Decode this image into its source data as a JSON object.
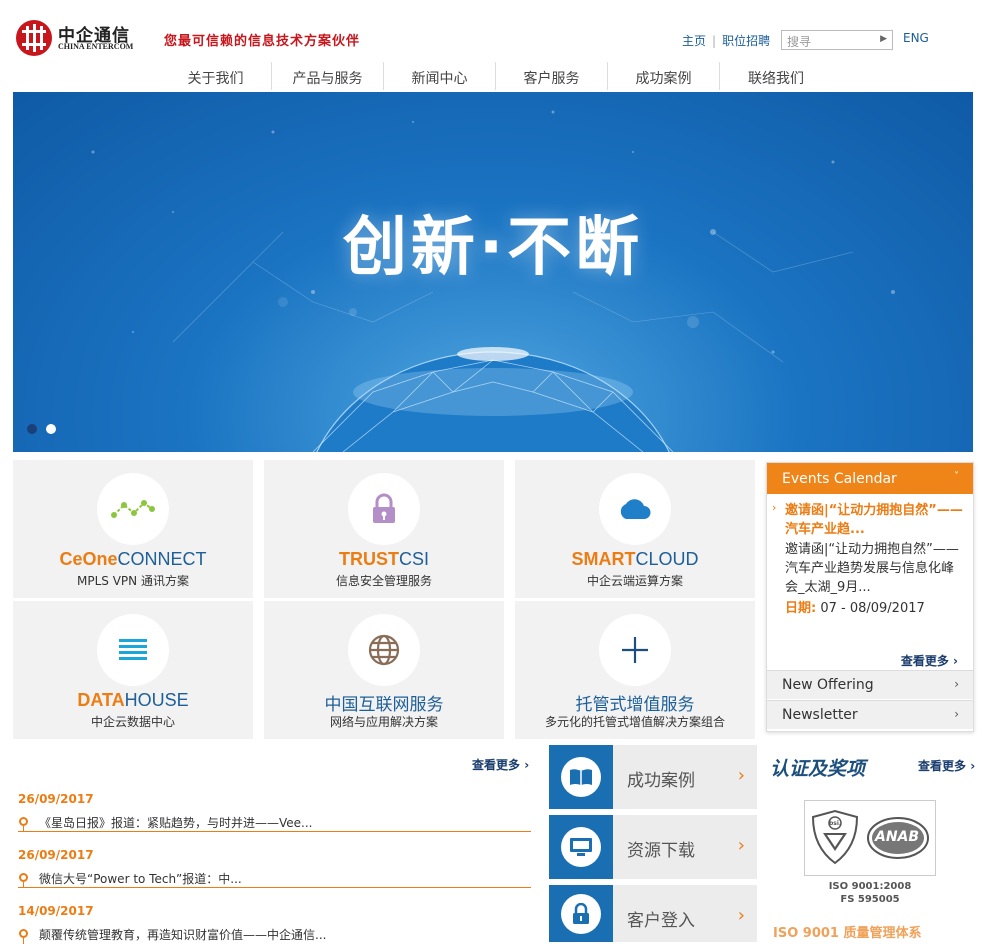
{
  "header": {
    "logo_cn": "中企通信",
    "logo_en": "CHINA ENTERCOM",
    "slogan": "您最可信赖的信息技术方案伙伴",
    "links": [
      "主页",
      "职位招聘"
    ],
    "search_placeholder": "搜寻",
    "lang": "ENG"
  },
  "nav": [
    "关于我们",
    "产品与服务",
    "新闻中心",
    "客户服务",
    "成功案例",
    "联络我们"
  ],
  "banner": {
    "title": "创新·不断",
    "active_slide": 1,
    "slide_count": 2
  },
  "tiles": [
    {
      "brand_a": "CeOne",
      "brand_b": "CONNECT",
      "sub": "MPLS VPN 通讯方案",
      "icon": "network-icon"
    },
    {
      "brand_a": "TRUST",
      "brand_b": "CSI",
      "sub": "信息安全管理服务",
      "icon": "lock-icon"
    },
    {
      "brand_a": "SMART",
      "brand_b": "CLOUD",
      "sub": "中企云端运算方案",
      "icon": "cloud-icon"
    },
    {
      "brand_a": "DATA",
      "brand_b": "HOUSE",
      "sub": "中企云数据中心",
      "icon": "list-icon"
    },
    {
      "title": "中国互联网服务",
      "sub": "网络与应用解决方案",
      "icon": "globe-icon"
    },
    {
      "title": "托管式增值服务",
      "sub": "多元化的托管式增值解决方案组合",
      "icon": "plus-icon"
    }
  ],
  "events": {
    "header": "Events Calendar",
    "item_title": "邀请函|“让动力拥抱自然”——汽车产业趋...",
    "item_desc": "邀请函|“让动力拥抱自然”——汽车产业趋势发展与信息化峰会_太湖_9月...",
    "date_label": "日期:",
    "date_value": "07 - 08/09/2017",
    "more": "查看更多",
    "rows": [
      "New Offering",
      "Newsletter"
    ]
  },
  "news": {
    "more": "查看更多",
    "items": [
      {
        "date": "26/09/2017",
        "text": "《星岛日报》报道：紧贴趋势，与时并进——Vee..."
      },
      {
        "date": "26/09/2017",
        "text": "微信大号“Power to Tech”报道：中..."
      },
      {
        "date": "14/09/2017",
        "text": "颠覆传统管理教育，再造知识财富价值——中企通信..."
      }
    ]
  },
  "quick_links": [
    {
      "label": "成功案例",
      "icon": "book-icon"
    },
    {
      "label": "资源下载",
      "icon": "monitor-icon"
    },
    {
      "label": "客户登入",
      "icon": "lock-icon"
    }
  ],
  "certs": {
    "title": "认证及奖项",
    "more": "查看更多",
    "iso_line1": "ISO 9001:2008",
    "iso_line2": "FS 595005",
    "footer": "ISO 9001 质量管理体系",
    "anab": "ANAB",
    "bsi": "bsi."
  },
  "colors": {
    "brand_red": "#c8161d",
    "accent_orange": "#ec7c14",
    "brand_blue": "#1a6fb3"
  }
}
